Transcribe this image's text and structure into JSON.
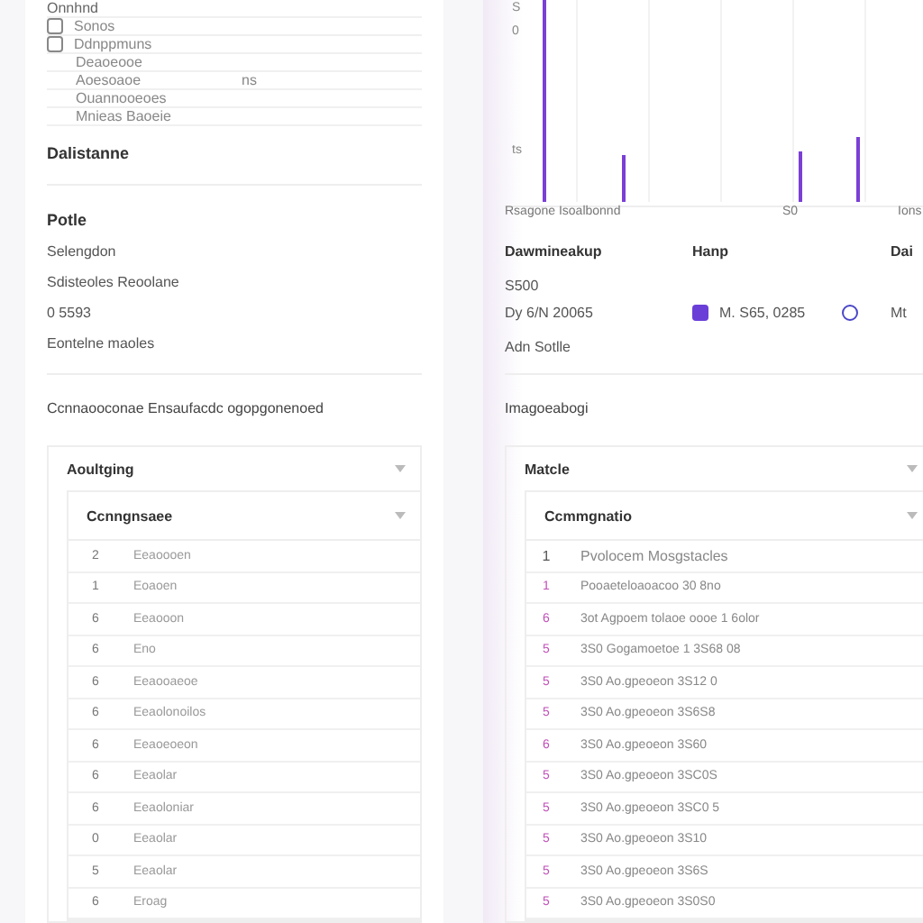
{
  "left": {
    "top_list": [
      {
        "label": "Onnhnd",
        "kind": "header"
      },
      {
        "label": "Sonos",
        "kind": "icon"
      },
      {
        "label": "Ddnppmuns",
        "kind": "icon"
      },
      {
        "label": "Deaoeooe",
        "kind": "sub"
      },
      {
        "label": "Aoesoaoe",
        "kind": "sub",
        "value": "ns"
      },
      {
        "label": "Ouannooeoes",
        "kind": "sub"
      },
      {
        "label": "Mnieas Baoeie",
        "kind": "sub"
      }
    ],
    "section_title": "Dalistanne",
    "details": [
      {
        "text": "Potle",
        "kind": "title"
      },
      {
        "text": "Selengdon",
        "kind": "line"
      },
      {
        "text": "Sdisteoles Reoolane",
        "kind": "line"
      },
      {
        "text": "0 5593",
        "kind": "value"
      },
      {
        "text": "Eontelne maoles",
        "kind": "line"
      }
    ],
    "note": "Ccnnaooconae Ensaufacdc ogopgonenoed",
    "panel": {
      "title": "Aoultging",
      "expanded": true,
      "inner": {
        "title": "Ccnngnsaee",
        "expanded": true,
        "rows": [
          {
            "num": "2",
            "text": "Eeaoooen"
          },
          {
            "num": "1",
            "text": "Eoaoen"
          },
          {
            "num": "6",
            "text": "Eeaooon"
          },
          {
            "num": "6",
            "text": "Eno"
          },
          {
            "num": "6",
            "text": "Eeaooaeoe"
          },
          {
            "num": "6",
            "text": "Eeaolonoilos"
          },
          {
            "num": "6",
            "text": "Eeaoeoeon"
          },
          {
            "num": "6",
            "text": "Eeaolar"
          },
          {
            "num": "6",
            "text": "Eeaoloniar"
          },
          {
            "num": "0",
            "text": "Eeaolar"
          },
          {
            "num": "5",
            "text": "Eeaolar"
          },
          {
            "num": "6",
            "text": "Eroag"
          }
        ]
      }
    }
  },
  "right": {
    "chart": {
      "y_labels": [
        "S",
        "0",
        "ts"
      ],
      "x_labels": [
        "Rsagone Isoalbonnd",
        "S0",
        "Ions"
      ]
    },
    "info": {
      "headers": [
        "Dawmineakup",
        "Hanp",
        "Dai"
      ],
      "amount": "S500",
      "date": "Dy 6/N 20065",
      "item_a": "M. S65, 0285",
      "item_b": "Mt",
      "footer": "Adn Sotlle"
    },
    "note": "Imagoeabogi",
    "panel": {
      "title": "Matcle",
      "expanded": true,
      "inner": {
        "title": "Ccmmgnatio",
        "expanded": true,
        "header": {
          "num": "1",
          "text": "Pvolocem Mosgstacles"
        },
        "rows": [
          {
            "num": "1",
            "text": "Pooaeteloaoacoo 30 8no"
          },
          {
            "num": "6",
            "text": "3ot Agpoem tolaoe oooe 1 6olor"
          },
          {
            "num": "5",
            "text": "3S0 Gogamoetoe 1 3S68 08"
          },
          {
            "num": "5",
            "text": "3S0 Ao.gpeoeon  3S12 0"
          },
          {
            "num": "5",
            "text": "3S0 Ao.gpeoeon  3S6S8"
          },
          {
            "num": "6",
            "text": "3S0 Ao.gpeoeon  3S60"
          },
          {
            "num": "5",
            "text": "3S0 Ao.gpeoeon  3SC0S"
          },
          {
            "num": "5",
            "text": "3S0 Ao.gpeoeon  3SC0 5"
          },
          {
            "num": "5",
            "text": "3S0 Ao.gpeoeon  3S10"
          },
          {
            "num": "5",
            "text": "3S0 Ao.gpeoeon  3S6S"
          },
          {
            "num": "5",
            "text": "3S0 Ao.gpeoeon  3S0S0"
          }
        ]
      }
    }
  }
}
